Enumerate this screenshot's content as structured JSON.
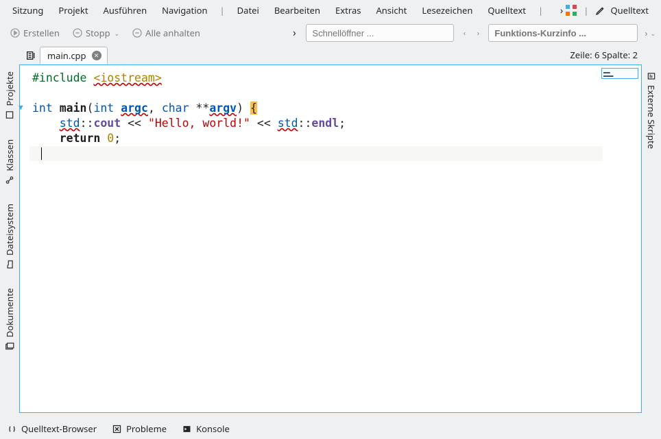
{
  "menubar": {
    "items": [
      "Sitzung",
      "Projekt",
      "Ausführen",
      "Navigation"
    ],
    "items2": [
      "Datei",
      "Bearbeiten",
      "Extras",
      "Ansicht",
      "Lesezeichen",
      "Quelltext"
    ],
    "sourceRight": "Quelltext"
  },
  "toolbar": {
    "build": "Erstellen",
    "stop": "Stopp",
    "stopAll": "Alle anhalten",
    "quickOpenPlaceholder": "Schnellöffner ...",
    "fnInfoPlaceholder": "Funktions-Kurzinfo ..."
  },
  "tab": {
    "name": "main.cpp"
  },
  "status": {
    "lineLabel": "Zeile:",
    "line": "6",
    "colLabel": "Spalte:",
    "col": "2"
  },
  "left_sidebar": {
    "items": [
      "Projekte",
      "Klassen",
      "Dateisystem",
      "Dokumente"
    ]
  },
  "right_sidebar": {
    "items": [
      "Externe Skripte"
    ]
  },
  "code": {
    "l1_pre": "#include",
    "l1_inc": "<iostream>",
    "l3_type": "int",
    "l3_fn": "main",
    "l3_p1t": "int",
    "l3_p1n": "argc",
    "l3_p2t": "char",
    "l3_p2n": "argv",
    "l4_ns1": "std",
    "l4_cout": "cout",
    "l4_str": "\"Hello, world!\"",
    "l4_ns2": "std",
    "l4_endl": "endl",
    "l5_ret": "return",
    "l5_num": "0"
  },
  "bottom": {
    "browser": "Quelltext-Browser",
    "problems": "Probleme",
    "console": "Konsole"
  }
}
